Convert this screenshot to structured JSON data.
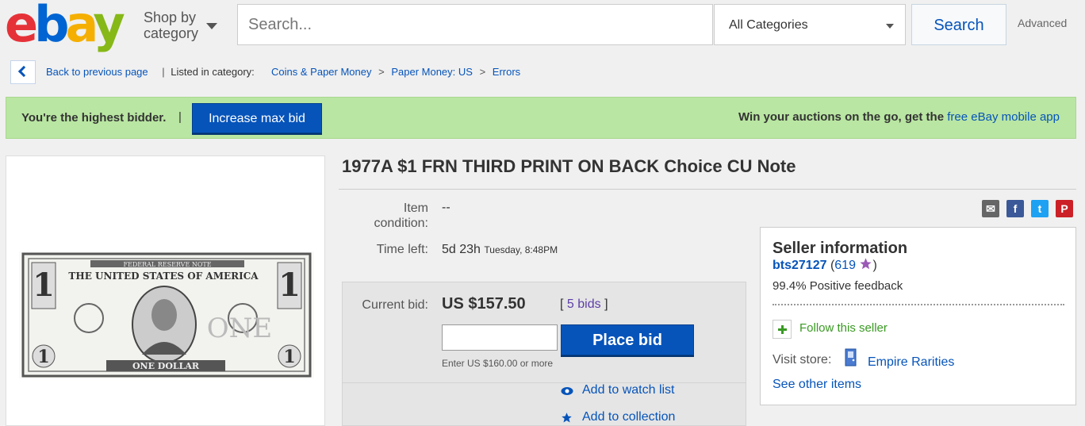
{
  "header": {
    "logo": "ebay",
    "logo_colors": [
      "#e53238",
      "#0064d2",
      "#f5af02",
      "#86b817"
    ],
    "shop_by_line1": "Shop by",
    "shop_by_line2": "category",
    "search_placeholder": "Search...",
    "category_value": "All Categories",
    "search_button": "Search",
    "advanced": "Advanced"
  },
  "breadcrumb": {
    "back": "Back to previous page",
    "listed_in": "Listed in category:",
    "crumbs": [
      "Coins & Paper Money",
      "Paper Money: US",
      "Errors"
    ],
    "separator": ">"
  },
  "banner": {
    "status": "You're the highest bidder.",
    "pipe": "|",
    "increase_button": "Increase max bid",
    "promo_text": "Win your auctions on the go, get the",
    "promo_link": "free eBay mobile app",
    "color": "#b9e6a2"
  },
  "note_image": {
    "top_text": "FEDERAL RESERVE NOTE",
    "country": "THE UNITED STATES OF AMERICA",
    "denomination_text": "ONE DOLLAR",
    "value_word": "ONE",
    "corner_value": "1"
  },
  "item": {
    "title": "1977A $1 FRN THIRD PRINT ON BACK Choice CU Note",
    "condition_label_1": "Item",
    "condition_label_2": "condition:",
    "condition_value": "--",
    "time_left_label": "Time left:",
    "time_left_value": "5d 23h",
    "time_left_detail": "Tuesday, 8:48PM"
  },
  "social": {
    "icons": [
      "email-icon",
      "facebook-icon",
      "twitter-icon",
      "pinterest-icon"
    ],
    "labels": [
      "✉",
      "f",
      "t",
      "P"
    ],
    "colors": [
      "#666666",
      "#3b5998",
      "#1da1f2",
      "#cb2027"
    ]
  },
  "bid": {
    "current_label": "Current bid:",
    "current_value": "US $157.50",
    "bids_open": "[",
    "bids_link": "5 bids",
    "bids_close": "]",
    "input_value": "",
    "place_button": "Place bid",
    "hint": "Enter US $160.00 or more",
    "watch": "Add to watch list",
    "collection": "Add to collection"
  },
  "seller": {
    "title": "Seller information",
    "name": "bts27127",
    "score_open": "(",
    "score": "619",
    "score_close": ")",
    "feedback": "99.4% Positive feedback",
    "follow": "Follow this seller",
    "visit_label": "Visit store:",
    "store_name": "Empire Rarities",
    "other_items": "See other items"
  }
}
